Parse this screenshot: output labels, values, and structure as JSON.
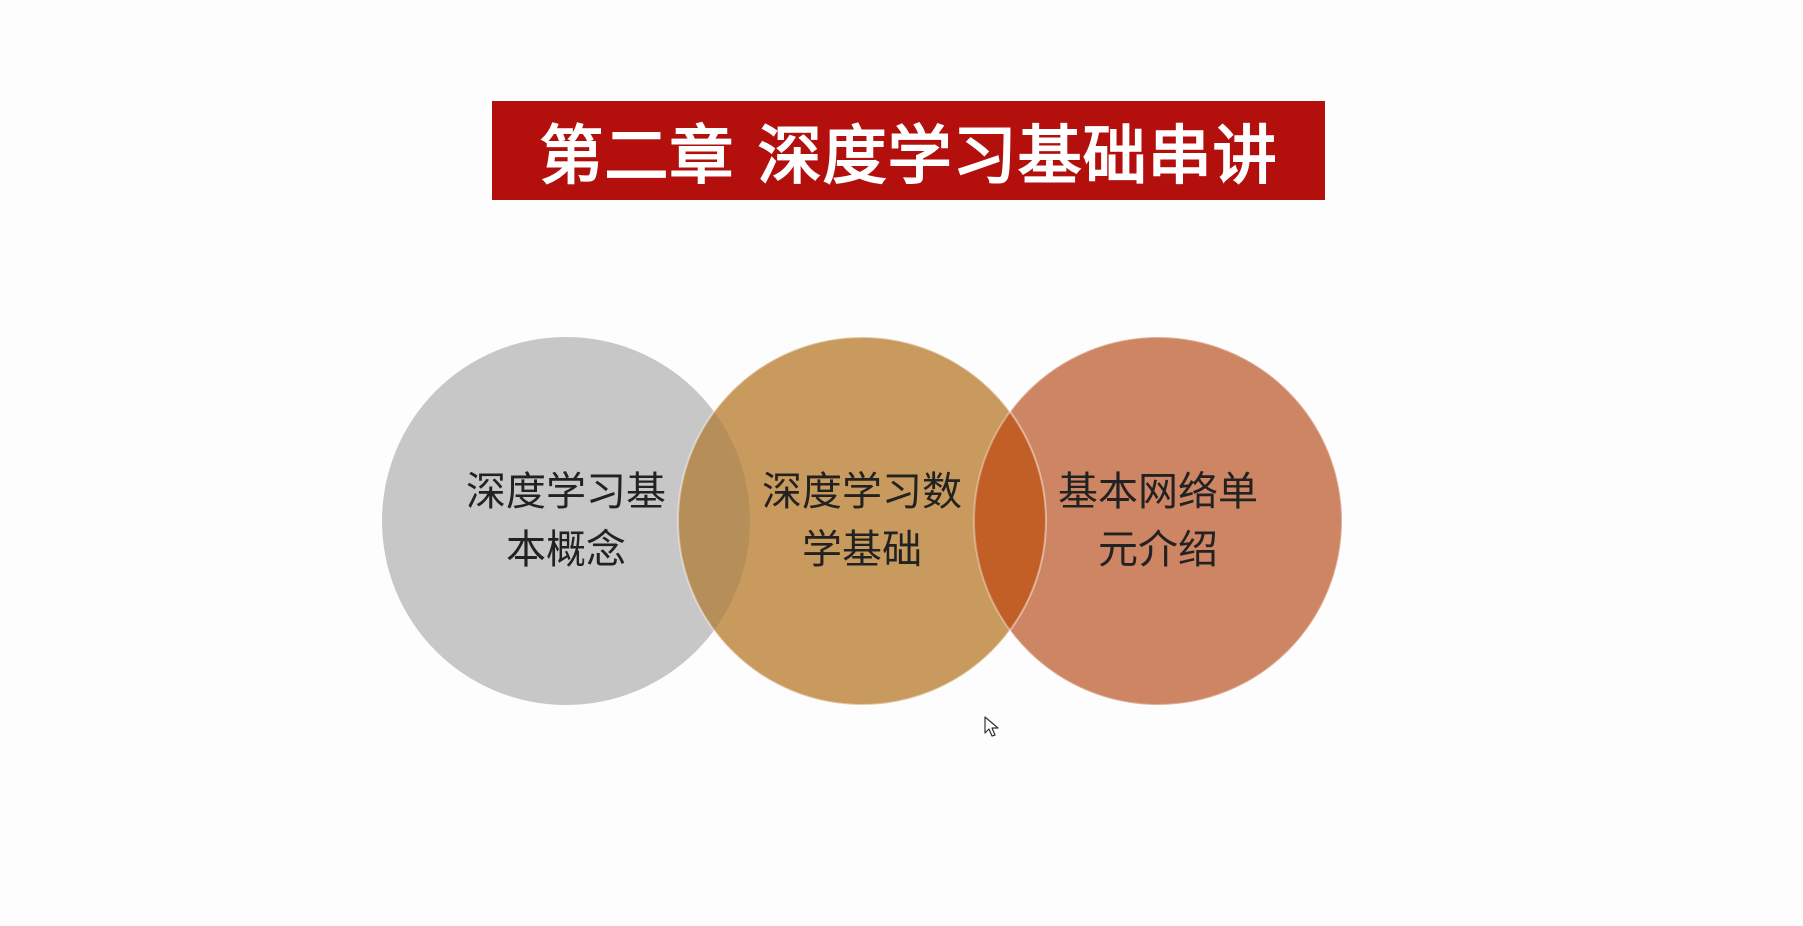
{
  "slide": {
    "title": "第二章 深度学习基础串讲",
    "banner_color": "#b30f0d",
    "circles": [
      {
        "label": "深度学习基\n本概念",
        "color": "#c7c7c7"
      },
      {
        "label": "深度学习数\n学基础",
        "color": "#c99a5e"
      },
      {
        "label": "基本网络单\n元介绍",
        "color": "#cd8563"
      }
    ],
    "overlap_colors": [
      "#b58e5a",
      "#c15f27"
    ]
  },
  "cursor": {
    "icon": "mouse-pointer-icon"
  }
}
